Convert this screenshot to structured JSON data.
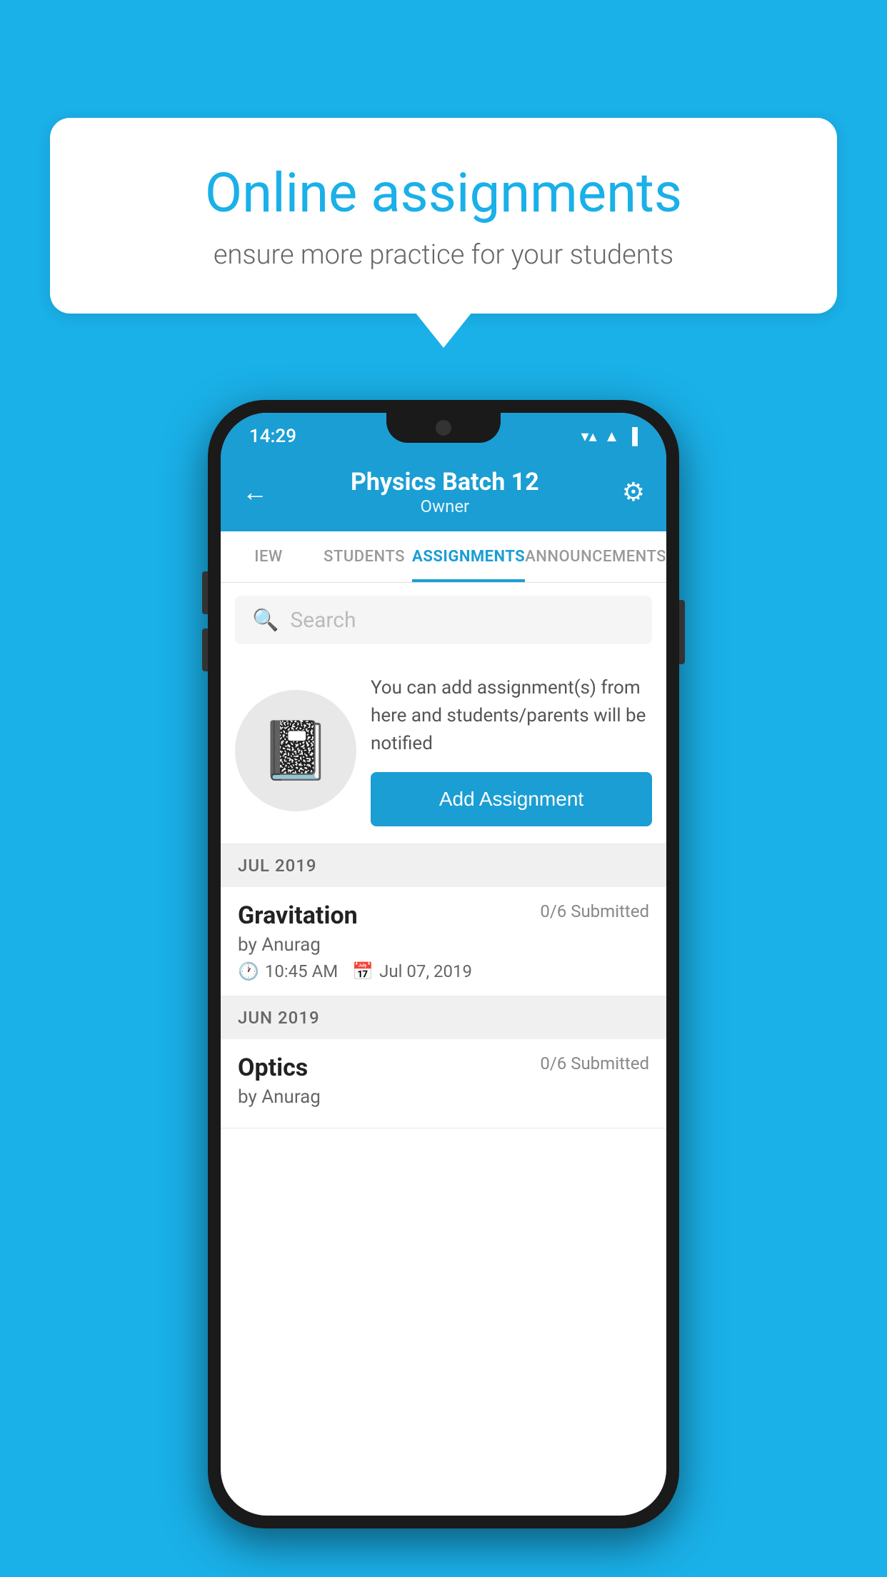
{
  "background_color": "#1ab0e8",
  "speech_bubble": {
    "title": "Online assignments",
    "subtitle": "ensure more practice for your students"
  },
  "phone": {
    "status_bar": {
      "time": "14:29",
      "wifi": "▼",
      "signal": "▲",
      "battery": "▐"
    },
    "header": {
      "title": "Physics Batch 12",
      "subtitle": "Owner",
      "back_label": "←",
      "settings_label": "⚙"
    },
    "tabs": [
      {
        "label": "IEW",
        "active": false
      },
      {
        "label": "STUDENTS",
        "active": false
      },
      {
        "label": "ASSIGNMENTS",
        "active": true
      },
      {
        "label": "ANNOUNCEMENTS",
        "active": false
      }
    ],
    "search": {
      "placeholder": "Search"
    },
    "add_assignment": {
      "description": "You can add assignment(s) from here and students/parents will be notified",
      "button_label": "Add Assignment"
    },
    "sections": [
      {
        "month": "JUL 2019",
        "assignments": [
          {
            "name": "Gravitation",
            "submitted": "0/6 Submitted",
            "author": "by Anurag",
            "time": "10:45 AM",
            "date": "Jul 07, 2019"
          }
        ]
      },
      {
        "month": "JUN 2019",
        "assignments": [
          {
            "name": "Optics",
            "submitted": "0/6 Submitted",
            "author": "by Anurag",
            "time": "",
            "date": ""
          }
        ]
      }
    ]
  }
}
